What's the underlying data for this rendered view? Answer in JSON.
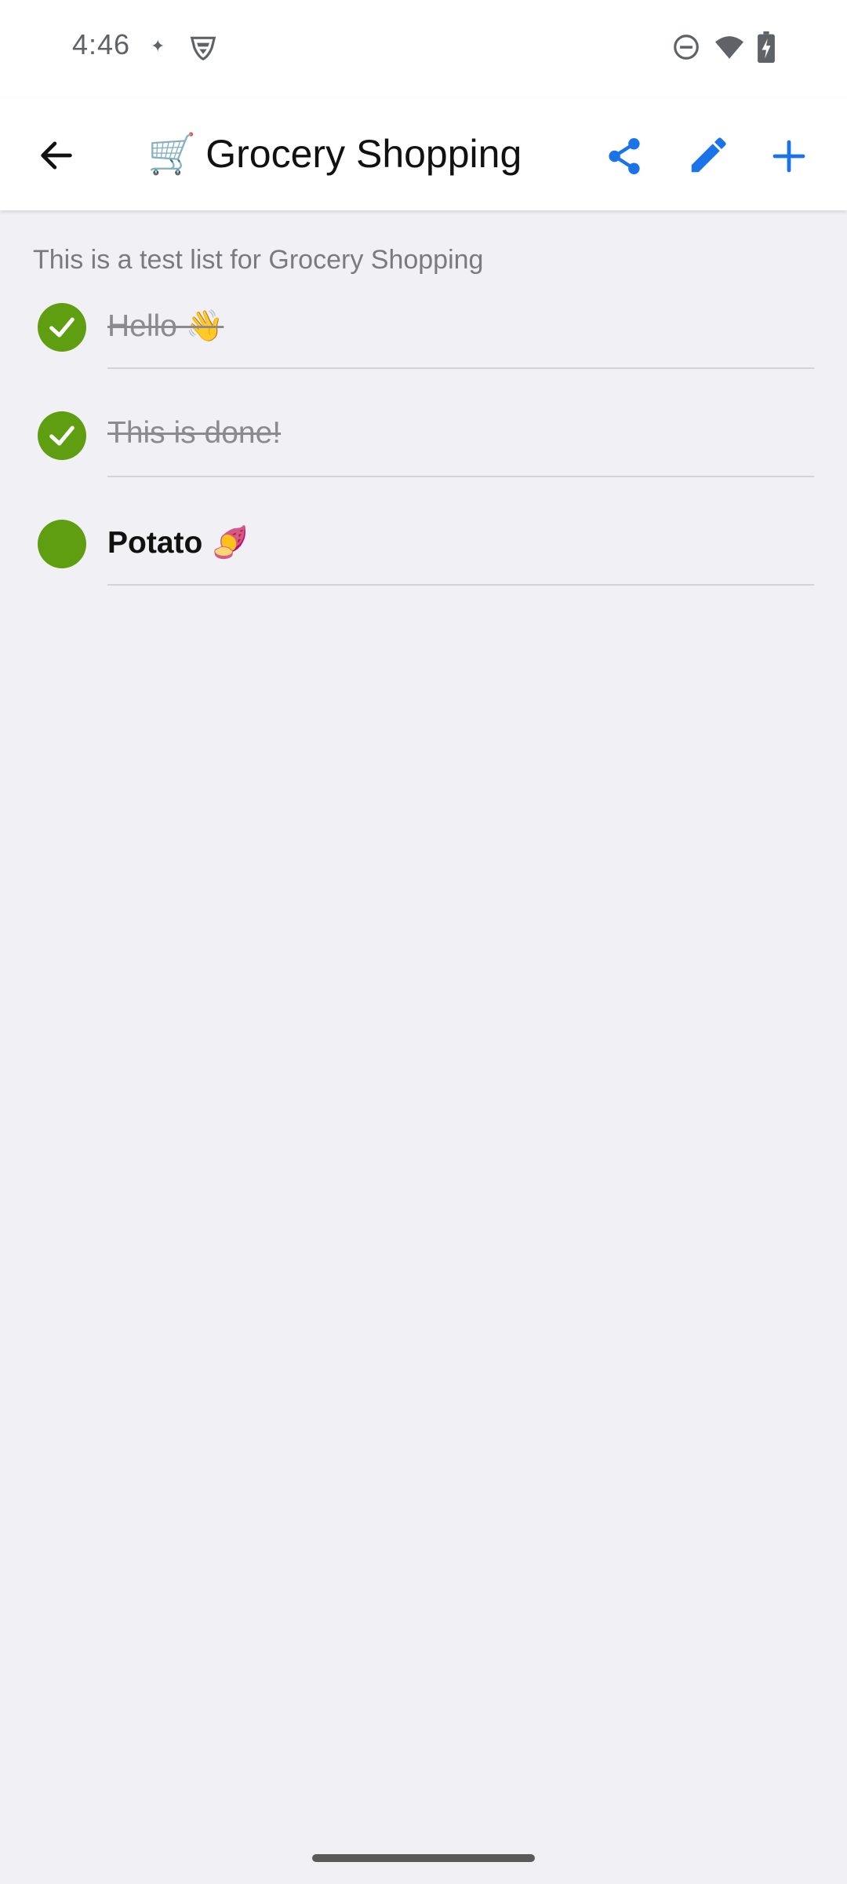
{
  "status_bar": {
    "time": "4:46",
    "icons": [
      "sparkle-icon",
      "vpn-shield-icon",
      "do-not-disturb-icon",
      "wifi-icon",
      "battery-charging-icon"
    ]
  },
  "app_bar": {
    "title_emoji": "🛒",
    "title": "Grocery Shopping",
    "icons": [
      "back-arrow-icon",
      "share-icon",
      "edit-pencil-icon",
      "add-plus-icon"
    ]
  },
  "colors": {
    "accent": "#1a73e8",
    "check_green": "#5f9e10",
    "background": "#f0f0f5"
  },
  "list": {
    "description": "This is a test list for Grocery Shopping",
    "items": [
      {
        "label": "Hello 👋",
        "done": true
      },
      {
        "label": "This is done!",
        "done": true
      },
      {
        "label": "Potato 🍠",
        "done": false
      }
    ]
  }
}
